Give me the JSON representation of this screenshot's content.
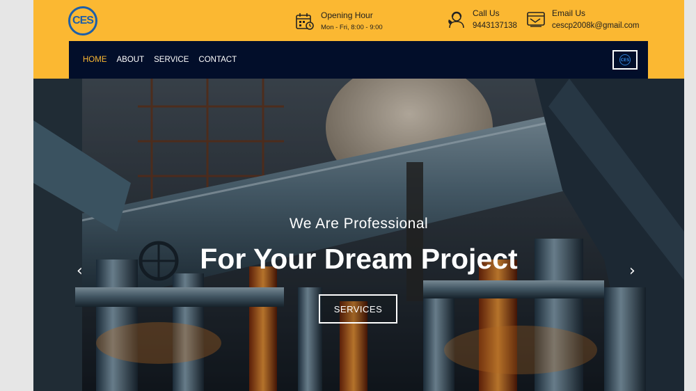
{
  "brand": {
    "logo_text": "CES"
  },
  "header": {
    "hours": {
      "icon": "calendar-icon",
      "title": "Opening Hour",
      "detail": "Mon - Fri, 8:00 - 9:00"
    },
    "call": {
      "icon": "phone-support-icon",
      "title": "Call Us",
      "detail": "9443137138"
    },
    "email": {
      "icon": "email-icon",
      "title": "Email Us",
      "detail": "cescp2008k@gmail.com"
    }
  },
  "nav": {
    "items": [
      "HOME",
      "ABOUT",
      "SERVICE",
      "CONTACT"
    ],
    "active": "HOME",
    "badge_text": "CES"
  },
  "hero": {
    "subtitle": "We Are Professional",
    "title": "For Your Dream Project",
    "button_label": "SERVICES",
    "prev_arrow": "‹",
    "next_arrow": "›"
  },
  "colors": {
    "accent": "#fbb832",
    "navbar": "#020e2a",
    "logo_blue": "#1e5fa8"
  }
}
